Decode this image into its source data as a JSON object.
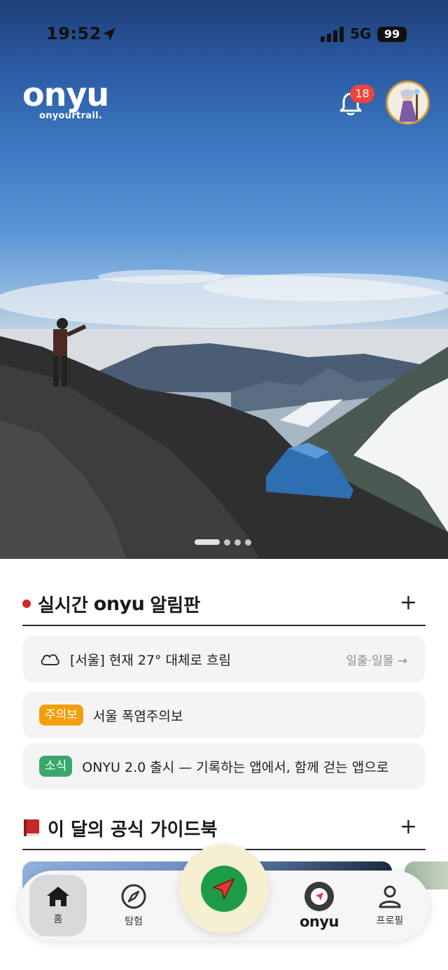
{
  "status_bar": {
    "time": "19:52",
    "network": "5G",
    "battery": "99"
  },
  "header": {
    "logo_wordmark": "onyu",
    "logo_tagline": "onyourtrail.",
    "notification_count": "18"
  },
  "hero": {
    "slides_count": 4,
    "active_slide": 1
  },
  "board": {
    "title_prefix": "실시간",
    "title_brand": "onyu",
    "title_suffix": "알림판",
    "add_label": "+",
    "weather_text": "[서울] 현재 27° 대체로 흐림",
    "weather_link": "일출·일몰 →",
    "alert_badge": "주의보",
    "alert_text": "서울 폭염주의보",
    "news_badge": "소식",
    "news_text": "ONYU 2.0 출시 — 기록하는 앱에서, 함께 걷는 앱으로"
  },
  "guidebook": {
    "title": "이 달의 공식 가이드북",
    "add_label": "+"
  },
  "tabbar": {
    "home_label": "홈",
    "explore_label": "탐험",
    "brand_label": "onyu",
    "profile_label": "프로필"
  },
  "colors": {
    "alert": "#f59e0b",
    "news": "#3aa76d",
    "badge": "#f0443a",
    "fab_inner": "#1e9b45",
    "fab_outer": "#f7efd2"
  },
  "icons": [
    "location-arrow-icon",
    "signal-icon",
    "bell-icon",
    "cloud-icon",
    "book-icon",
    "home-icon",
    "compass-icon",
    "navigate-icon",
    "onyu-brand-icon",
    "profile-icon"
  ]
}
